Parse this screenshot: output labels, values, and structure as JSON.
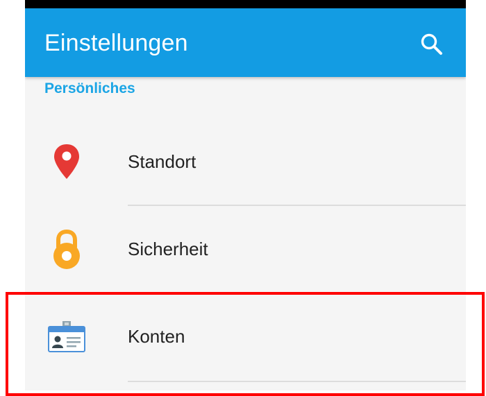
{
  "app_bar": {
    "title": "Einstellungen",
    "search_icon": "search-icon",
    "background_color": "#139ce3"
  },
  "section": {
    "header": "Persönliches",
    "header_color": "#1ba5e5"
  },
  "items": [
    {
      "label": "Standort",
      "icon": "location-pin-icon",
      "icon_color": "#e53935"
    },
    {
      "label": "Sicherheit",
      "icon": "padlock-icon",
      "icon_color": "#f9a825"
    },
    {
      "label": "Konten",
      "icon": "account-card-icon",
      "icon_color": "#4a90d9"
    }
  ],
  "highlight_color": "#ff0000"
}
